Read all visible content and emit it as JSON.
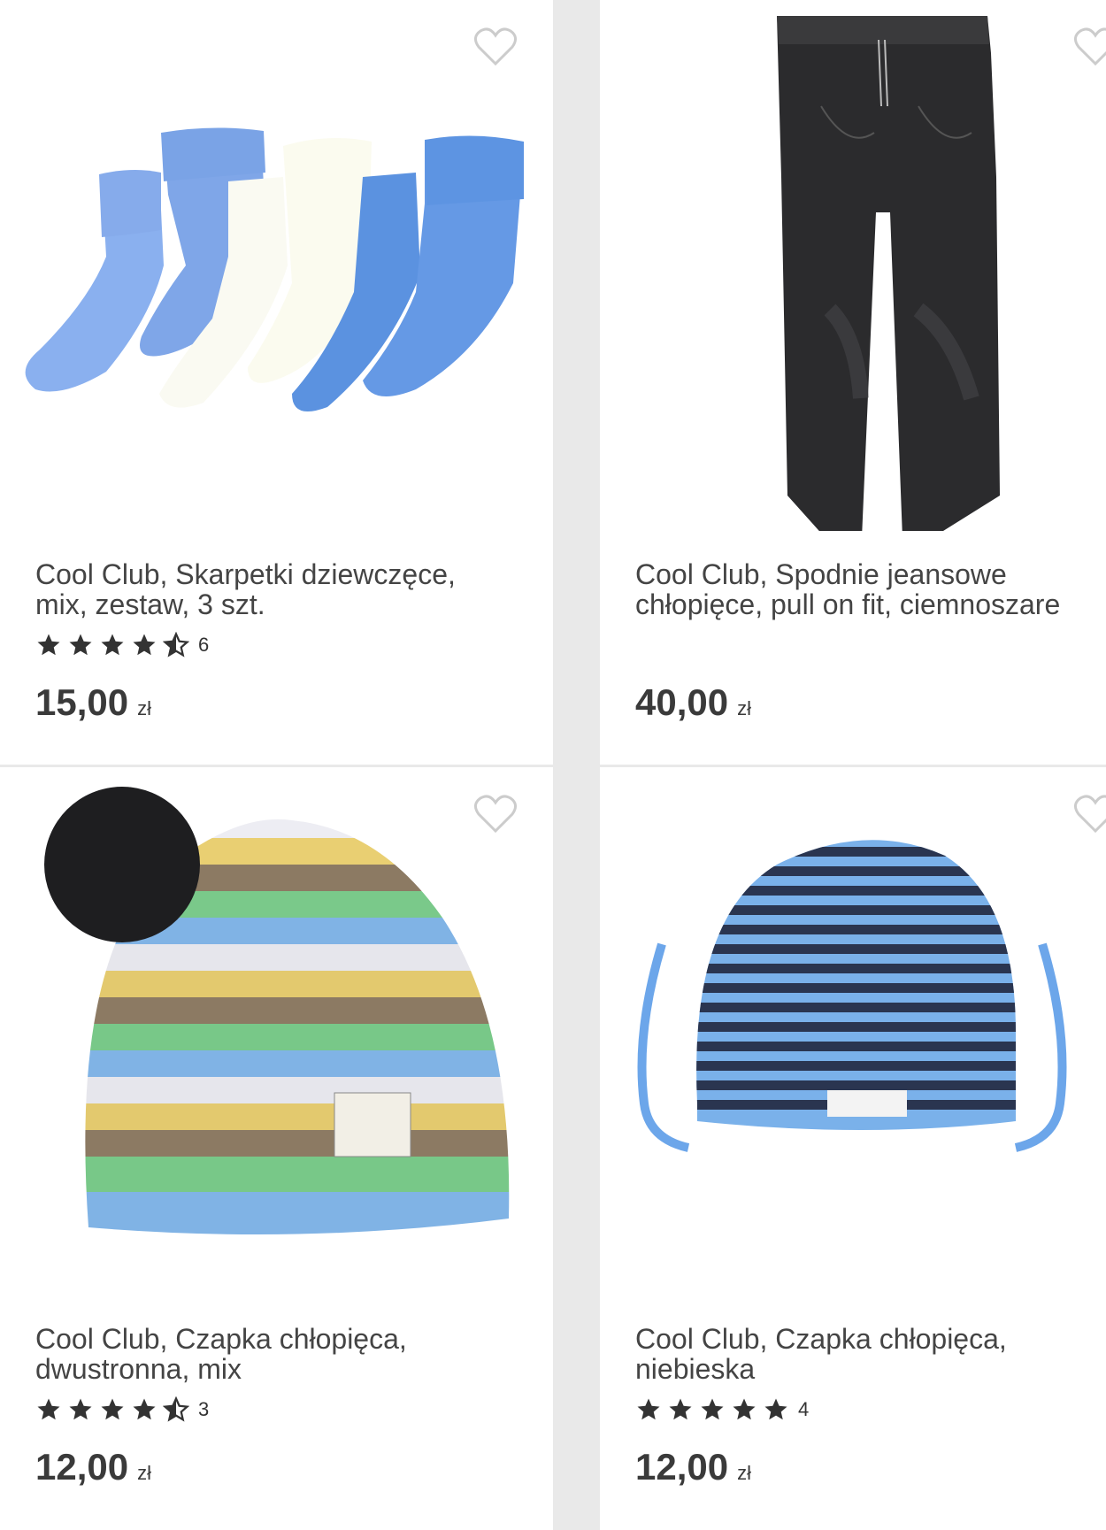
{
  "products": [
    {
      "title": "Cool Club, Skarpetki dziewczęce, mix, zestaw, 3 szt.",
      "rating_count": "6",
      "price": "15,00",
      "currency": "zł",
      "rating": 4.5,
      "image_icon": "socks-image"
    },
    {
      "title": "Cool Club, Spodnie jeansowe chłopięce, pull on fit, ciemnoszare",
      "price": "40,00",
      "currency": "zł",
      "image_icon": "jeans-image"
    },
    {
      "title": "Cool Club, Czapka chłopięca, dwustronna, mix",
      "rating_count": "3",
      "price": "12,00",
      "currency": "zł",
      "rating": 4.5,
      "image_icon": "striped-beanie-image"
    },
    {
      "title": "Cool Club, Czapka chłopięca, niebieska",
      "rating_count": "4",
      "price": "12,00",
      "currency": "zł",
      "rating": 5,
      "image_icon": "striped-baby-hat-image"
    }
  ],
  "colors": {
    "star": "#333333",
    "heart_outline": "#cccccc",
    "background": "#e9e9e9"
  }
}
